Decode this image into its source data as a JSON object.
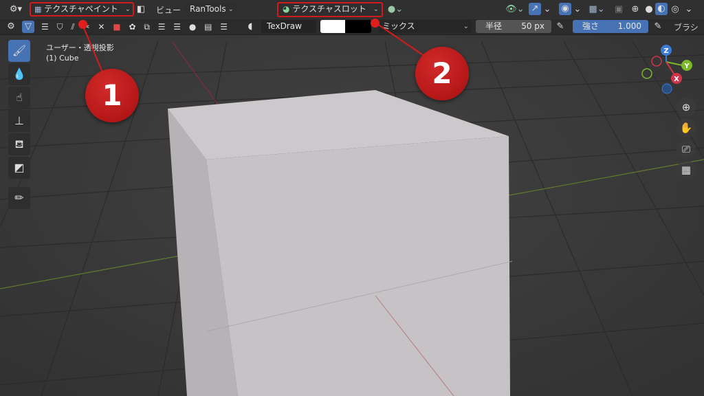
{
  "header": {
    "editor_icon": "editor-type-icon",
    "mode_label": "テクスチャペイント",
    "view_menu": "ビュー",
    "addon_menu": "RanTools",
    "texture_slot_label": "テクスチャスロット"
  },
  "tool_header": {
    "texture_name": "TexDraw",
    "blend_mode": "ミックス",
    "radius_label": "半径",
    "radius_value": "50 px",
    "strength_label": "強さ",
    "strength_value": "1.000",
    "brush_label": "ブラシ"
  },
  "viewport": {
    "view_name": "ユーザー・透視投影",
    "object_name": "(1) Cube"
  },
  "gizmo": {
    "z": "Z",
    "y": "Y",
    "x": "X"
  },
  "annotations": {
    "badge1": "1",
    "badge2": "2"
  },
  "colors": {
    "accent": "#4772b3",
    "annotation_red": "#d21c1c",
    "cube": "#c9c5c8"
  }
}
